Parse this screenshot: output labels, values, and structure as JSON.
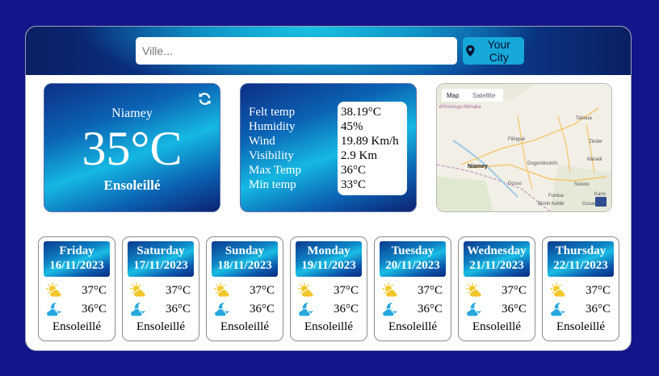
{
  "header": {
    "search_placeholder": "Ville...",
    "city_button_label": "Your City"
  },
  "current": {
    "city": "Niamey",
    "temperature": "35°C",
    "condition": "Ensoleillé"
  },
  "details": {
    "labels": [
      "Felt temp",
      "Humidity",
      "Wind",
      "Visibility",
      "Max Temp",
      "Min temp"
    ],
    "values": [
      "38.19°C",
      "45%",
      "19.89 Km/h",
      "2.9 Km",
      "36°C",
      "33°C"
    ]
  },
  "map": {
    "tab_map": "Map",
    "tab_satellite": "Satellite",
    "region_label": "d'Ansongo-Ménaka",
    "places": [
      "Niamey",
      "Filingué",
      "Tahoua",
      "Dosso",
      "Sokoto",
      "Birnin Kebbi",
      "Dogondoutchi",
      "Gusau",
      "Funtua",
      "Maradi",
      "Zinder",
      "Kano"
    ]
  },
  "forecast": [
    {
      "day": "Friday",
      "date": "16/11/2023",
      "max": "37°C",
      "min": "36°C",
      "condition": "Ensoleillé"
    },
    {
      "day": "Saturday",
      "date": "17/11/2023",
      "max": "37°C",
      "min": "36°C",
      "condition": "Ensoleillé"
    },
    {
      "day": "Sunday",
      "date": "18/11/2023",
      "max": "37°C",
      "min": "36°C",
      "condition": "Ensoleillé"
    },
    {
      "day": "Monday",
      "date": "19/11/2023",
      "max": "37°C",
      "min": "36°C",
      "condition": "Ensoleillé"
    },
    {
      "day": "Tuesday",
      "date": "20/11/2023",
      "max": "37°C",
      "min": "36°C",
      "condition": "Ensoleillé"
    },
    {
      "day": "Wednesday",
      "date": "21/11/2023",
      "max": "37°C",
      "min": "36°C",
      "condition": "Ensoleillé"
    },
    {
      "day": "Thursday",
      "date": "22/11/2023",
      "max": "37°C",
      "min": "36°C",
      "condition": "Ensoleillé"
    }
  ],
  "colors": {
    "page_background": "#13168a",
    "accent": "#16a8d8",
    "sun_icon": "#f2c72a",
    "moon_icon": "#27a8dd"
  },
  "icons": {
    "city_button": "location-pin-icon",
    "refresh": "refresh-icon",
    "day_forecast": "sun-cloud-icon",
    "night_forecast": "moon-cloud-icon"
  }
}
